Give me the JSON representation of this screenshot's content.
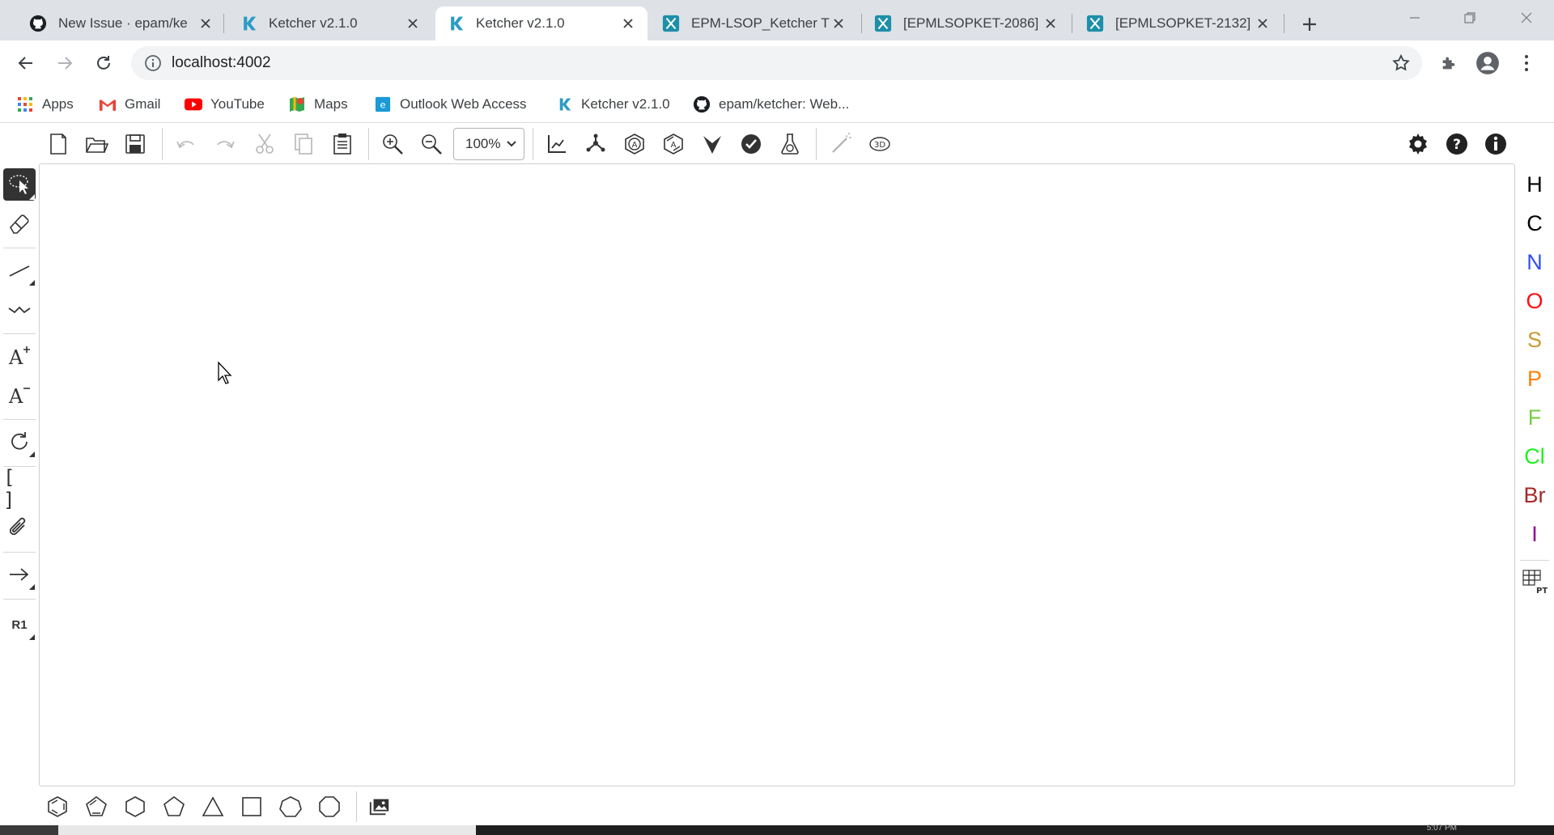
{
  "browser": {
    "tabs": [
      {
        "title": "New Issue · epam/ke",
        "icon": "github-icon",
        "active": false
      },
      {
        "title": "Ketcher v2.1.0",
        "icon": "ketcher-icon",
        "active": false
      },
      {
        "title": "Ketcher v2.1.0",
        "icon": "ketcher-icon",
        "active": true
      },
      {
        "title": "EPM-LSOP_Ketcher T",
        "icon": "jira-icon",
        "active": false
      },
      {
        "title": "[EPMLSOPKET-2086]",
        "icon": "jira-icon",
        "active": false
      },
      {
        "title": "[EPMLSOPKET-2132]",
        "icon": "jira-icon",
        "active": false
      }
    ],
    "url": "localhost:4002",
    "bookmarks": [
      {
        "label": "Apps",
        "icon": "apps-grid-icon"
      },
      {
        "label": "Gmail",
        "icon": "gmail-icon"
      },
      {
        "label": "YouTube",
        "icon": "youtube-icon"
      },
      {
        "label": "Maps",
        "icon": "maps-icon"
      },
      {
        "label": "Outlook Web Access",
        "icon": "outlook-icon"
      },
      {
        "label": "Ketcher v2.1.0",
        "icon": "ketcher-icon"
      },
      {
        "label": "epam/ketcher: Web...",
        "icon": "github-icon"
      }
    ]
  },
  "ketcher": {
    "zoom": "100%",
    "atoms": [
      {
        "symbol": "H",
        "color": "#000000"
      },
      {
        "symbol": "C",
        "color": "#000000"
      },
      {
        "symbol": "N",
        "color": "#304ff7"
      },
      {
        "symbol": "O",
        "color": "#ff0d0d"
      },
      {
        "symbol": "S",
        "color": "#c99a2e"
      },
      {
        "symbol": "P",
        "color": "#ff8000"
      },
      {
        "symbol": "F",
        "color": "#78cc40"
      },
      {
        "symbol": "Cl",
        "color": "#1ff01f"
      },
      {
        "symbol": "Br",
        "color": "#a62929"
      },
      {
        "symbol": "I",
        "color": "#940094"
      }
    ],
    "periodic_table_label": "PT",
    "rgroup_label": "R1",
    "bracket_label": "[ ]"
  },
  "taskbar": {
    "clock": "5:07 PM"
  }
}
